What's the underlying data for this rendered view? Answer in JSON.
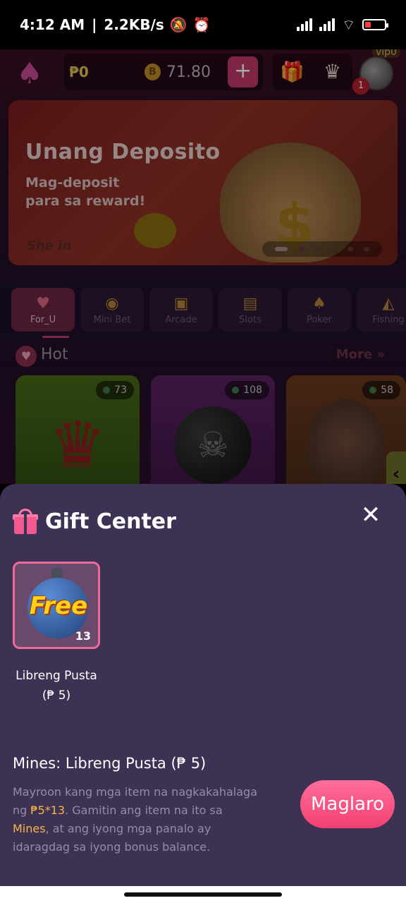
{
  "status": {
    "time": "4:12 AM",
    "net_speed": "2.2KB/s"
  },
  "header": {
    "peso_balance": "₱0",
    "bonus_balance": "71.80",
    "vip_label": "vip0",
    "notif_count": "1"
  },
  "banner": {
    "title": "Unang Deposito",
    "subtitle_line1": "Mag-deposit",
    "subtitle_line2": "para sa reward!",
    "footer": "She  in"
  },
  "categories": [
    {
      "label": "For_U"
    },
    {
      "label": "Mini Bet"
    },
    {
      "label": "Arcade"
    },
    {
      "label": "Slots"
    },
    {
      "label": "Poker"
    },
    {
      "label": "Fishing"
    }
  ],
  "hot": {
    "label": "Hot",
    "more": "More"
  },
  "games": [
    {
      "players": "73"
    },
    {
      "players": "108"
    },
    {
      "players": "58"
    }
  ],
  "gift_center": {
    "title": "Gift Center",
    "item_art_text": "Free",
    "item_count": "13",
    "item_name_line1": "Libreng Pusta",
    "item_name_line2": "(₱ 5)",
    "detail_title": "Mines: Libreng Pusta (₱ 5)",
    "desc_part1": "Mayroon kang mga item na nagkakahalaga ng ",
    "desc_value": "₱5*13",
    "desc_part2": ". Gamitin ang item na ito sa ",
    "desc_game": "Mines",
    "desc_part3": ", at ang iyong mga panalo ay idaragdag sa iyong bonus balance.",
    "play_label": "Maglaro"
  },
  "colors": {
    "accent": "#f23f73",
    "sheet_bg": "#3d3154",
    "highlight": "#f5b64a"
  }
}
